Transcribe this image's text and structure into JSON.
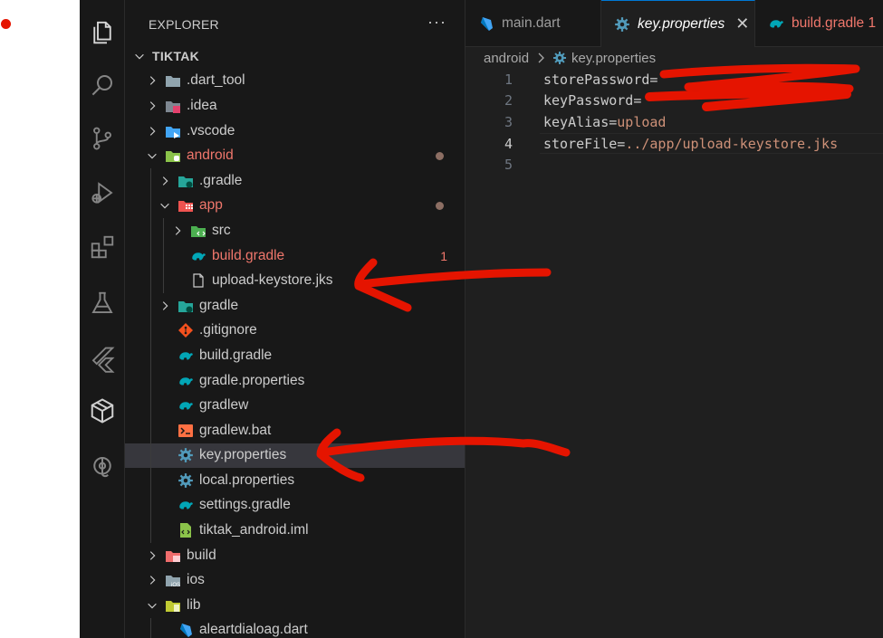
{
  "explorer": {
    "header": "EXPLORER",
    "more": "···"
  },
  "tree": [
    {
      "label": "TIKTAK",
      "depth": 0,
      "chevron": "down",
      "icon": "",
      "style": "bold"
    },
    {
      "label": ".dart_tool",
      "depth": 1,
      "chevron": "right",
      "icon": "folder-icon"
    },
    {
      "label": ".idea",
      "depth": 1,
      "chevron": "right",
      "icon": "folder-idea-icon"
    },
    {
      "label": ".vscode",
      "depth": 1,
      "chevron": "right",
      "icon": "folder-vscode-icon"
    },
    {
      "label": "android",
      "depth": 1,
      "chevron": "down",
      "icon": "folder-android-icon",
      "style": "modified",
      "dot": true
    },
    {
      "label": ".gradle",
      "depth": 2,
      "chevron": "right",
      "icon": "folder-gradle-icon"
    },
    {
      "label": "app",
      "depth": 2,
      "chevron": "down",
      "icon": "folder-app-icon",
      "style": "modified",
      "dot": true
    },
    {
      "label": "src",
      "depth": 3,
      "chevron": "right",
      "icon": "folder-src-icon"
    },
    {
      "label": "build.gradle",
      "depth": 3,
      "chevron": "none",
      "icon": "gradle-icon",
      "style": "modified",
      "count": "1"
    },
    {
      "label": "upload-keystore.jks",
      "depth": 3,
      "chevron": "none",
      "icon": "file-icon"
    },
    {
      "label": "gradle",
      "depth": 2,
      "chevron": "right",
      "icon": "folder-gradle-icon"
    },
    {
      "label": ".gitignore",
      "depth": 2,
      "chevron": "none",
      "icon": "git-icon"
    },
    {
      "label": "build.gradle",
      "depth": 2,
      "chevron": "none",
      "icon": "gradle-icon"
    },
    {
      "label": "gradle.properties",
      "depth": 2,
      "chevron": "none",
      "icon": "gradle-icon"
    },
    {
      "label": "gradlew",
      "depth": 2,
      "chevron": "none",
      "icon": "gradle-icon"
    },
    {
      "label": "gradlew.bat",
      "depth": 2,
      "chevron": "none",
      "icon": "terminal-icon"
    },
    {
      "label": "key.properties",
      "depth": 2,
      "chevron": "none",
      "icon": "gear-icon",
      "selected": true
    },
    {
      "label": "local.properties",
      "depth": 2,
      "chevron": "none",
      "icon": "gear-icon"
    },
    {
      "label": "settings.gradle",
      "depth": 2,
      "chevron": "none",
      "icon": "gradle-icon"
    },
    {
      "label": "tiktak_android.iml",
      "depth": 2,
      "chevron": "none",
      "icon": "iml-icon"
    },
    {
      "label": "build",
      "depth": 1,
      "chevron": "right",
      "icon": "folder-build-icon"
    },
    {
      "label": "ios",
      "depth": 1,
      "chevron": "right",
      "icon": "folder-ios-icon"
    },
    {
      "label": "lib",
      "depth": 1,
      "chevron": "down",
      "icon": "folder-lib-icon"
    },
    {
      "label": "aleartdialoag.dart",
      "depth": 2,
      "chevron": "none",
      "icon": "dart-icon"
    }
  ],
  "tabs": [
    {
      "label": "main.dart",
      "icon": "dart-icon",
      "active": false
    },
    {
      "label": "key.properties",
      "icon": "gear-icon",
      "active": true,
      "close": "✕"
    },
    {
      "label": "build.gradle 1",
      "icon": "gradle-icon",
      "active": false,
      "style": "modified"
    }
  ],
  "breadcrumb": {
    "folder": "android",
    "file": "key.properties"
  },
  "code": [
    {
      "n": "1",
      "key": "storePassword",
      "eq": "=",
      "value": ""
    },
    {
      "n": "2",
      "key": "keyPassword",
      "eq": "=",
      "value": ""
    },
    {
      "n": "3",
      "key": "keyAlias",
      "eq": "=",
      "value": "upload"
    },
    {
      "n": "4",
      "key": "storeFile",
      "eq": "=",
      "value": "../app/upload-keystore.jks",
      "current": true
    },
    {
      "n": "5",
      "key": "",
      "eq": "",
      "value": ""
    }
  ],
  "colors": {
    "accent": "#0078d4",
    "modified": "#f0776c",
    "annotation": "#e51400"
  }
}
